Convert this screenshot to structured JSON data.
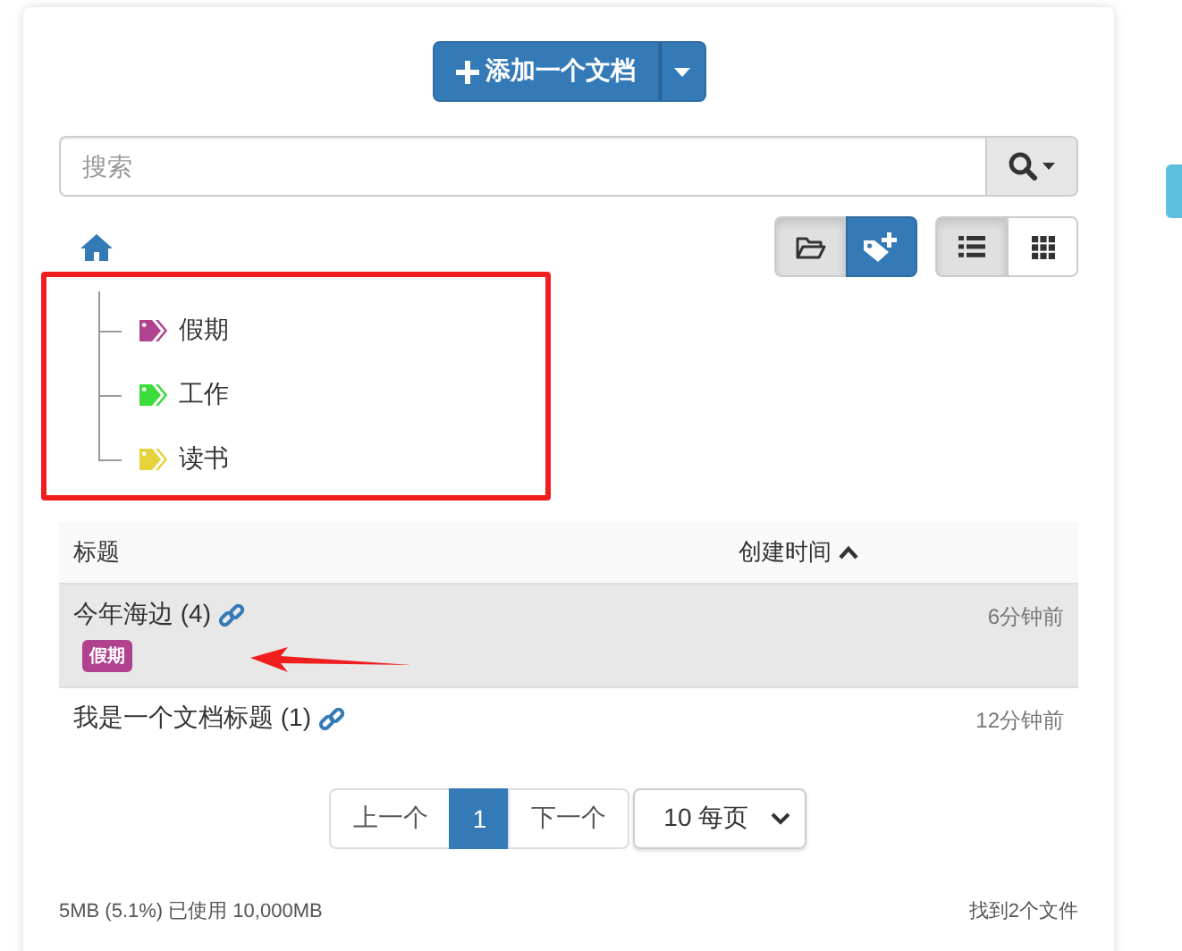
{
  "add_button": {
    "label": "添加一个文档"
  },
  "search": {
    "placeholder": "搜索"
  },
  "folder_toggle": {
    "selected": true
  },
  "layout_toggles": [
    {
      "kind": "list",
      "selected": true
    },
    {
      "kind": "grid",
      "selected": false
    }
  ],
  "tags": [
    {
      "label": "假期",
      "color": "#b0428f"
    },
    {
      "label": "工作",
      "color": "#3ddc3d"
    },
    {
      "label": "读书",
      "color": "#e6d23a"
    }
  ],
  "table": {
    "columns": [
      "标题",
      "创建时间"
    ],
    "rows": [
      {
        "title": "今年海边 (4)",
        "time": "6分钟前",
        "selected": true,
        "tags": [
          {
            "label": "假期",
            "color": "#b0428f"
          }
        ]
      },
      {
        "title": "我是一个文档标题 (1)",
        "time": "12分钟前",
        "selected": false,
        "tags": []
      }
    ]
  },
  "pagination": {
    "prev": "上一个",
    "pages": [
      {
        "label": "1",
        "selected": true
      }
    ],
    "next": "下一个",
    "page_size": "10 每页"
  },
  "footer": {
    "usage": "5MB (5.1%) 已使用 10,000MB",
    "count": "找到2个文件"
  }
}
